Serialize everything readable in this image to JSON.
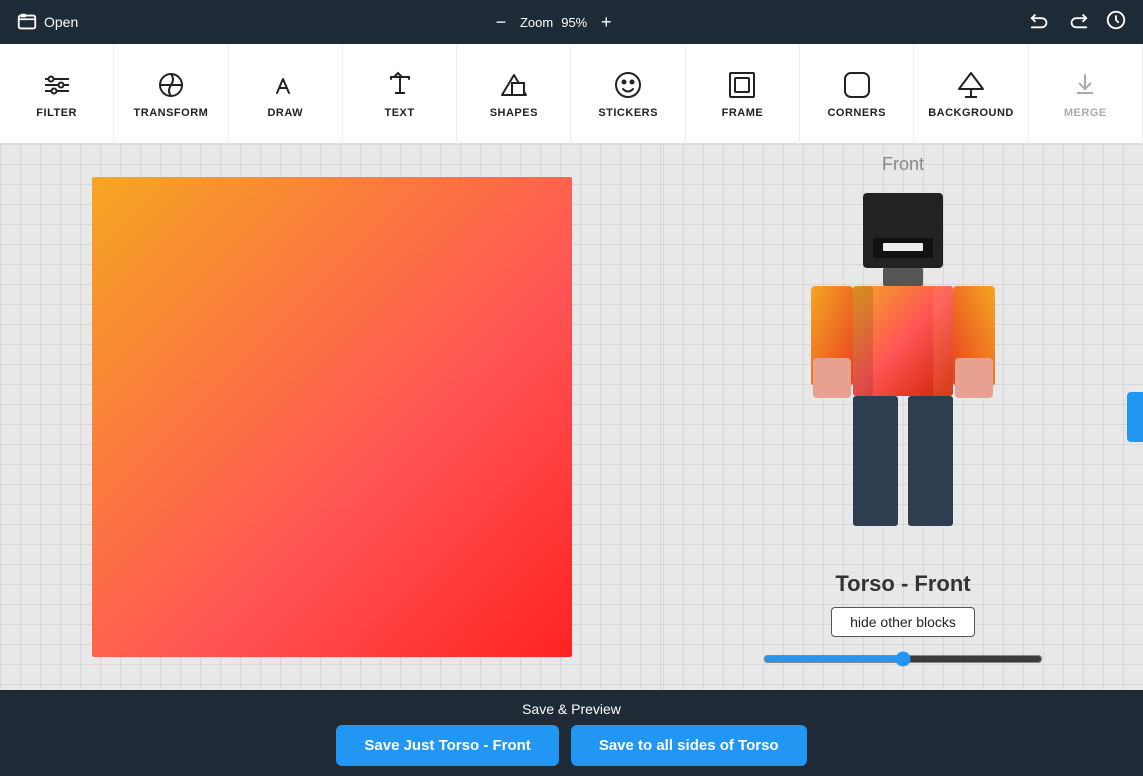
{
  "topbar": {
    "open_label": "Open",
    "zoom_label": "Zoom",
    "zoom_value": "95%",
    "zoom_minus": "−",
    "zoom_plus": "+"
  },
  "toolbar": {
    "items": [
      {
        "id": "filter",
        "label": "FILTER",
        "icon": "filter"
      },
      {
        "id": "transform",
        "label": "TRANSFORM",
        "icon": "transform"
      },
      {
        "id": "draw",
        "label": "DRAW",
        "icon": "draw"
      },
      {
        "id": "text",
        "label": "TEXT",
        "icon": "text"
      },
      {
        "id": "shapes",
        "label": "SHAPES",
        "icon": "shapes"
      },
      {
        "id": "stickers",
        "label": "STICKERS",
        "icon": "stickers"
      },
      {
        "id": "frame",
        "label": "FRAME",
        "icon": "frame"
      },
      {
        "id": "corners",
        "label": "CORNERS",
        "icon": "corners"
      },
      {
        "id": "background",
        "label": "BACKGROUND",
        "icon": "background"
      },
      {
        "id": "merge",
        "label": "MERGE",
        "icon": "merge",
        "disabled": true
      }
    ]
  },
  "preview": {
    "side_label": "Front",
    "part_name": "Torso - Front",
    "hide_blocks_btn": "hide other blocks",
    "slider_value": 50
  },
  "bottom": {
    "save_preview": "Save & Preview",
    "save_just_front": "Save Just Torso - Front",
    "save_all_sides": "Save to all sides of Torso"
  }
}
